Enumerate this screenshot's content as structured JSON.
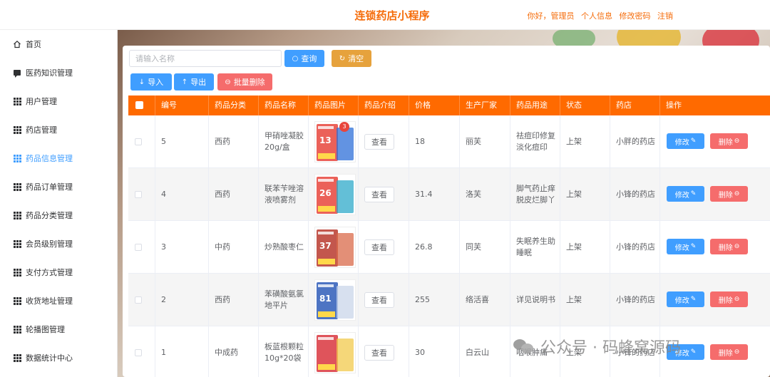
{
  "header": {
    "title": "连锁药店小程序",
    "greeting": "你好，管理员",
    "profile": "个人信息",
    "change_password": "修改密码",
    "logout": "注销"
  },
  "sidebar": {
    "items": [
      {
        "label": "首页",
        "icon": "home-icon"
      },
      {
        "label": "医药知识管理",
        "icon": "chat-icon"
      },
      {
        "label": "用户管理",
        "icon": "grid-icon"
      },
      {
        "label": "药店管理",
        "icon": "grid-icon"
      },
      {
        "label": "药品信息管理",
        "icon": "grid-icon",
        "active": true
      },
      {
        "label": "药品订单管理",
        "icon": "grid-icon"
      },
      {
        "label": "药品分类管理",
        "icon": "grid-icon"
      },
      {
        "label": "会员级别管理",
        "icon": "grid-icon"
      },
      {
        "label": "支付方式管理",
        "icon": "grid-icon"
      },
      {
        "label": "收货地址管理",
        "icon": "grid-icon"
      },
      {
        "label": "轮播图管理",
        "icon": "grid-icon"
      },
      {
        "label": "数据统计中心",
        "icon": "grid-icon"
      }
    ]
  },
  "toolbar": {
    "search_placeholder": "请输入名称",
    "query": "查询",
    "clear": "清空",
    "import": "导入",
    "export": "导出",
    "batch_delete": "批量删除"
  },
  "table": {
    "headers": [
      "编号",
      "药品分类",
      "药品名称",
      "药品图片",
      "药品介绍",
      "价格",
      "生产厂家",
      "药品用途",
      "状态",
      "药店",
      "操作"
    ],
    "view_label": "查看",
    "edit_label": "修改",
    "delete_label": "删除",
    "rows": [
      {
        "id": "5",
        "category": "西药",
        "name": "甲硝唑凝胶\n20g/盒",
        "price": "18",
        "maker": "丽芙",
        "usage": "祛痘印修复\n淡化痘印",
        "status": "上架",
        "store": "小胖的药店",
        "img": {
          "main": "#e8453c",
          "second": "#2e6fd8",
          "badge1": "13",
          "badge2": "3"
        }
      },
      {
        "id": "4",
        "category": "西药",
        "name": "联苯苄唑溶\n液喷雾剂",
        "price": "31.4",
        "maker": "洛芙",
        "usage": "脚气药止痒\n脱皮烂脚丫",
        "status": "上架",
        "store": "小锋的药店",
        "img": {
          "main": "#e8453c",
          "second": "#2fa9c9",
          "badge1": "26",
          "badge2": ""
        }
      },
      {
        "id": "3",
        "category": "中药",
        "name": "炒熟酸枣仁",
        "price": "26.8",
        "maker": "同芙",
        "usage": "失眠养生助\n睡眠",
        "status": "上架",
        "store": "小锋的药店",
        "img": {
          "main": "#b93a2e",
          "second": "#d96a4a",
          "badge1": "37",
          "badge2": ""
        }
      },
      {
        "id": "2",
        "category": "西药",
        "name": "苯磺酸氨氯\n地平片",
        "price": "255",
        "maker": "络活喜",
        "usage": "详见说明书",
        "status": "上架",
        "store": "小锋的药店",
        "img": {
          "main": "#2e5cb8",
          "second": "#c9d6ea",
          "badge1": "81",
          "badge2": ""
        }
      },
      {
        "id": "1",
        "category": "中成药",
        "name": "板蓝根颗粒\n10g*20袋",
        "price": "30",
        "maker": "白云山",
        "usage": "咽喉肿痛",
        "status": "上架",
        "store": "小锋的药店",
        "img": {
          "main": "#d9363e",
          "second": "#f2c94c",
          "badge1": "",
          "badge2": ""
        }
      }
    ]
  },
  "watermark": {
    "text": "公众号 · 码蜂窝源码"
  },
  "colors": {
    "accent": "#ff6a00",
    "primary": "#409eff",
    "danger": "#f56c6c",
    "warning": "#e6a23c",
    "title": "#f56c0a"
  }
}
